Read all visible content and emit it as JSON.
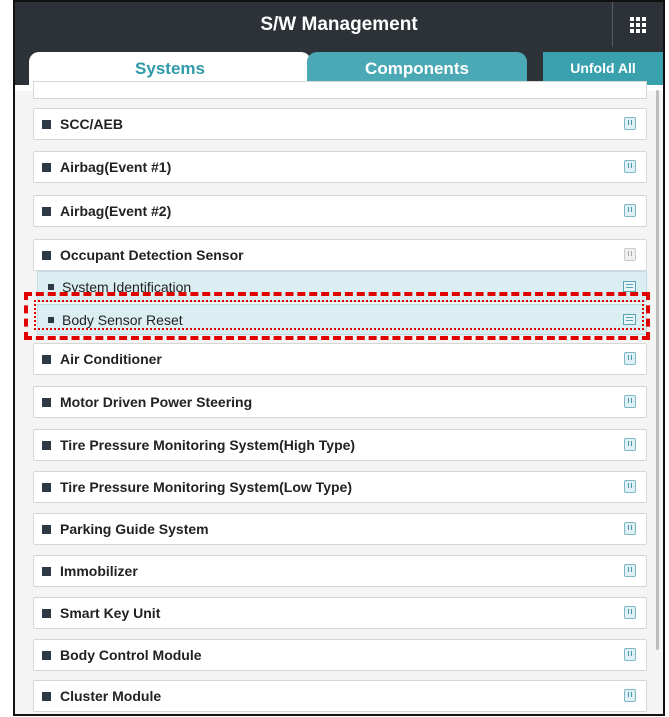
{
  "header": {
    "title": "S/W Management",
    "menu_icon": "grid-icon"
  },
  "tabs": [
    {
      "label": "Systems",
      "active": true
    },
    {
      "label": "Components",
      "active": false
    }
  ],
  "unfold_all_label": "Unfold All",
  "list": {
    "items": [
      {
        "label": "SCC/AEB",
        "state": "collapsed"
      },
      {
        "label": "Airbag(Event #1)",
        "state": "collapsed"
      },
      {
        "label": "Airbag(Event #2)",
        "state": "collapsed"
      },
      {
        "label": "Occupant Detection Sensor",
        "state": "expanded"
      },
      {
        "label": "Air Conditioner",
        "state": "collapsed"
      },
      {
        "label": "Motor Driven Power Steering",
        "state": "collapsed"
      },
      {
        "label": "Tire Pressure Monitoring System(High Type)",
        "state": "collapsed"
      },
      {
        "label": "Tire Pressure Monitoring System(Low Type)",
        "state": "collapsed"
      },
      {
        "label": "Parking Guide System",
        "state": "collapsed"
      },
      {
        "label": "Immobilizer",
        "state": "collapsed"
      },
      {
        "label": "Smart Key Unit",
        "state": "collapsed"
      },
      {
        "label": "Body Control Module",
        "state": "collapsed"
      },
      {
        "label": "Cluster Module",
        "state": "collapsed"
      }
    ],
    "sub_items": [
      {
        "label": "System Identification"
      },
      {
        "label": "Body Sensor Reset",
        "highlighted": true
      }
    ]
  },
  "colors": {
    "header": "#2d3238",
    "accent": "#2f9aa9",
    "highlight": "#e10000"
  }
}
